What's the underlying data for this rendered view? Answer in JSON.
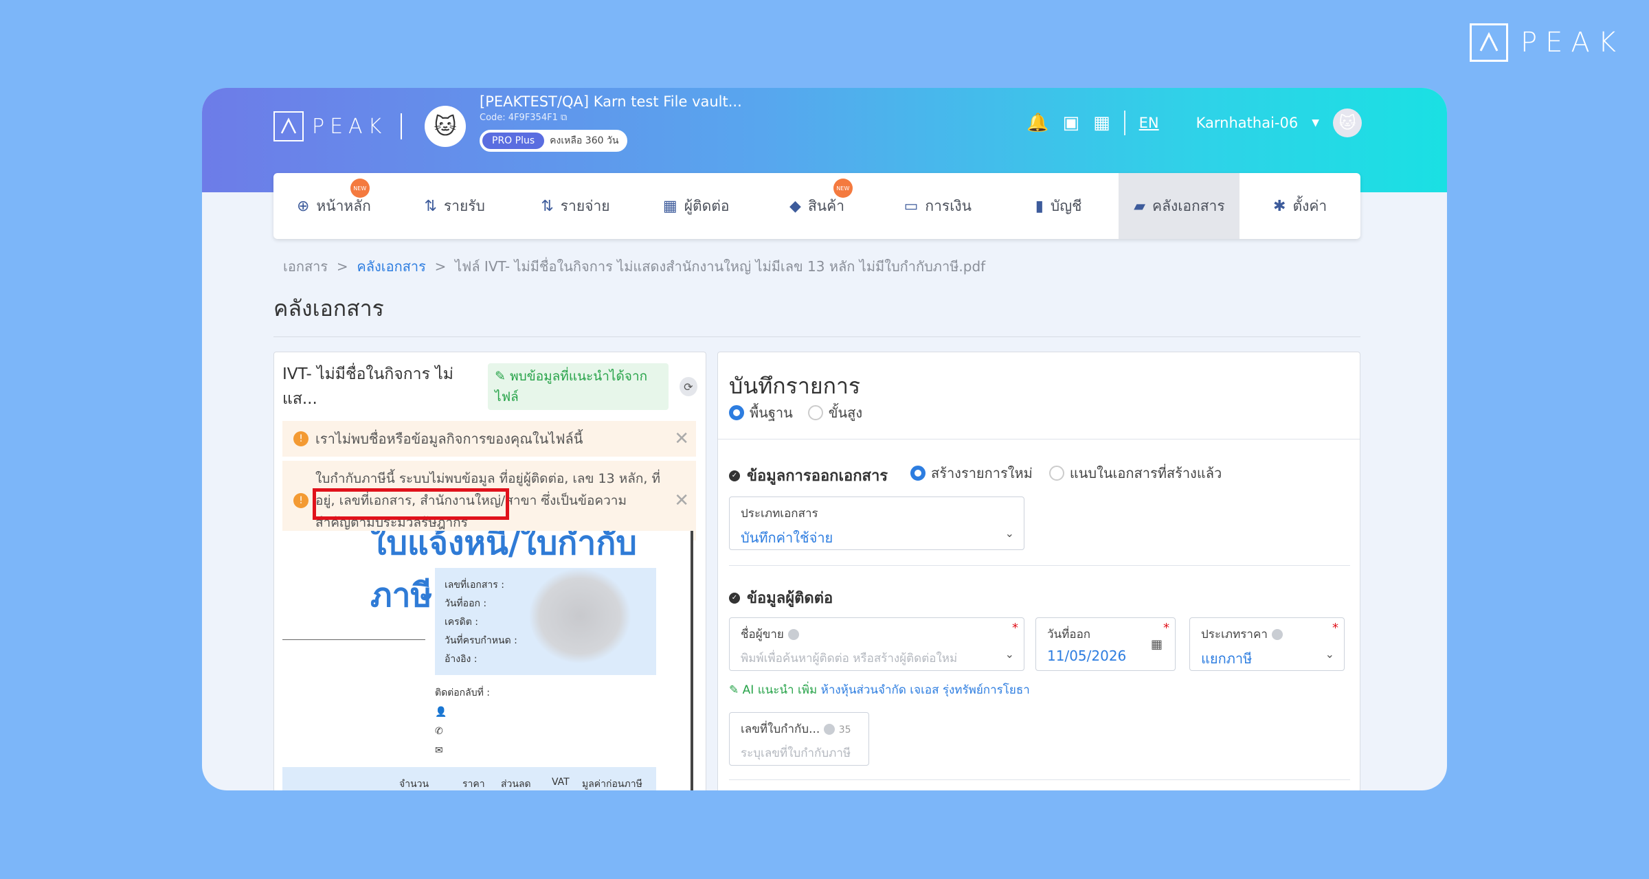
{
  "brand": {
    "name": "PEAK",
    "logo_glyph": "Λ"
  },
  "header": {
    "company_name": "[PEAKTEST/QA] Karn test File vault...",
    "company_code": "Code: 4F9F354F1",
    "plan": "PRO Plus",
    "plan_remaining": "คงเหลือ 360 วัน",
    "lang": "EN",
    "user": "Karnhathai-06"
  },
  "nav": [
    {
      "label": "หน้าหลัก",
      "icon": "⊕",
      "new": true
    },
    {
      "label": "รายรับ",
      "icon": "⇅",
      "new": false
    },
    {
      "label": "รายจ่าย",
      "icon": "⇅",
      "new": false
    },
    {
      "label": "ผู้ติดต่อ",
      "icon": "▦",
      "new": false
    },
    {
      "label": "สินค้า",
      "icon": "◆",
      "new": true
    },
    {
      "label": "การเงิน",
      "icon": "▭",
      "new": false
    },
    {
      "label": "บัญชี",
      "icon": "▮",
      "new": false
    },
    {
      "label": "คลังเอกสาร",
      "icon": "▰",
      "new": false,
      "active": true
    },
    {
      "label": "ตั้งค่า",
      "icon": "✱",
      "new": false
    }
  ],
  "badge_new_text": "NEW",
  "breadcrumb": {
    "root": "เอกสาร",
    "sep": ">",
    "link": "คลังเอกสาร",
    "current": "ไฟล์ IVT- ไม่มีชื่อในกิจการ ไม่แสดงสำนักงานใหญ่ ไม่มีเลข 13 หลัก ไม่มีใบกำกับภาษี.pdf"
  },
  "page_title": "คลังเอกสาร",
  "left_pane": {
    "file_title": "IVT- ไม่มีชื่อในกิจการ ไม่แส...",
    "ai_chip": "พบข้อมูลที่แนะนำได้จากไฟล์",
    "warning1": "เราไม่พบชื่อหรือข้อมูลกิจการของคุณในไฟล์นี้",
    "warning2": "ใบกำกับภาษีนี้ ระบบไม่พบข้อมูล ที่อยู่ผู้ติดต่อ, เลข 13 หลัก, ที่อยู่, เลขที่เอกสาร, สำนักงานใหญ่/สาขา ซึ่งเป็นข้อความสำคัญตามประมวลรัษฎากร",
    "doc": {
      "heading": "ใบแจ้งหนี้/ใบกำกับภาษี",
      "fields": [
        "เลขที่เอกสาร :",
        "วันที่ออก :",
        "เครดิต :",
        "วันที่ครบกำหนด :",
        "อ้างอิง :"
      ],
      "contact_label": "ติดต่อกลับที่ :",
      "table_headers": [
        "จำนวน",
        "ราคา",
        "ส่วนลด",
        "VAT",
        "มูลค่าก่อนภาษี"
      ]
    }
  },
  "right_pane": {
    "title": "บันทึกรายการ",
    "mode_basic": "พื้นฐาน",
    "mode_advanced": "ขั้นสูง",
    "section_doc": "ข้อมูลการออกเอกสาร",
    "opt_new": "สร้างรายการใหม่",
    "opt_attach": "แนบในเอกสารที่สร้างแล้ว",
    "doc_type_label": "ประเภทเอกสาร",
    "doc_type_value": "บันทึกค่าใช้จ่าย",
    "section_contact": "ข้อมูลผู้ติดต่อ",
    "vendor_label": "ชื่อผู้ขาย",
    "vendor_placeholder": "พิมพ์เพื่อค้นหาผู้ติดต่อ หรือสร้างผู้ติดต่อใหม่",
    "issue_date_label": "วันที่ออก",
    "issue_date_value": "11/05/2026",
    "price_type_label": "ประเภทราคา",
    "price_type_value": "แยกภาษี",
    "ai_note_prefix": "AI แนะนำ เพิ่ม",
    "ai_note_link": "ห้างหุ้นส่วนจำกัด เจเอส รุ่งทรัพย์การโยธา",
    "tax_no_label": "เลขที่ใบกำกับ...",
    "tax_no_counter": "35",
    "tax_no_placeholder": "ระบุเลขที่ใบกำกับภาษี"
  }
}
